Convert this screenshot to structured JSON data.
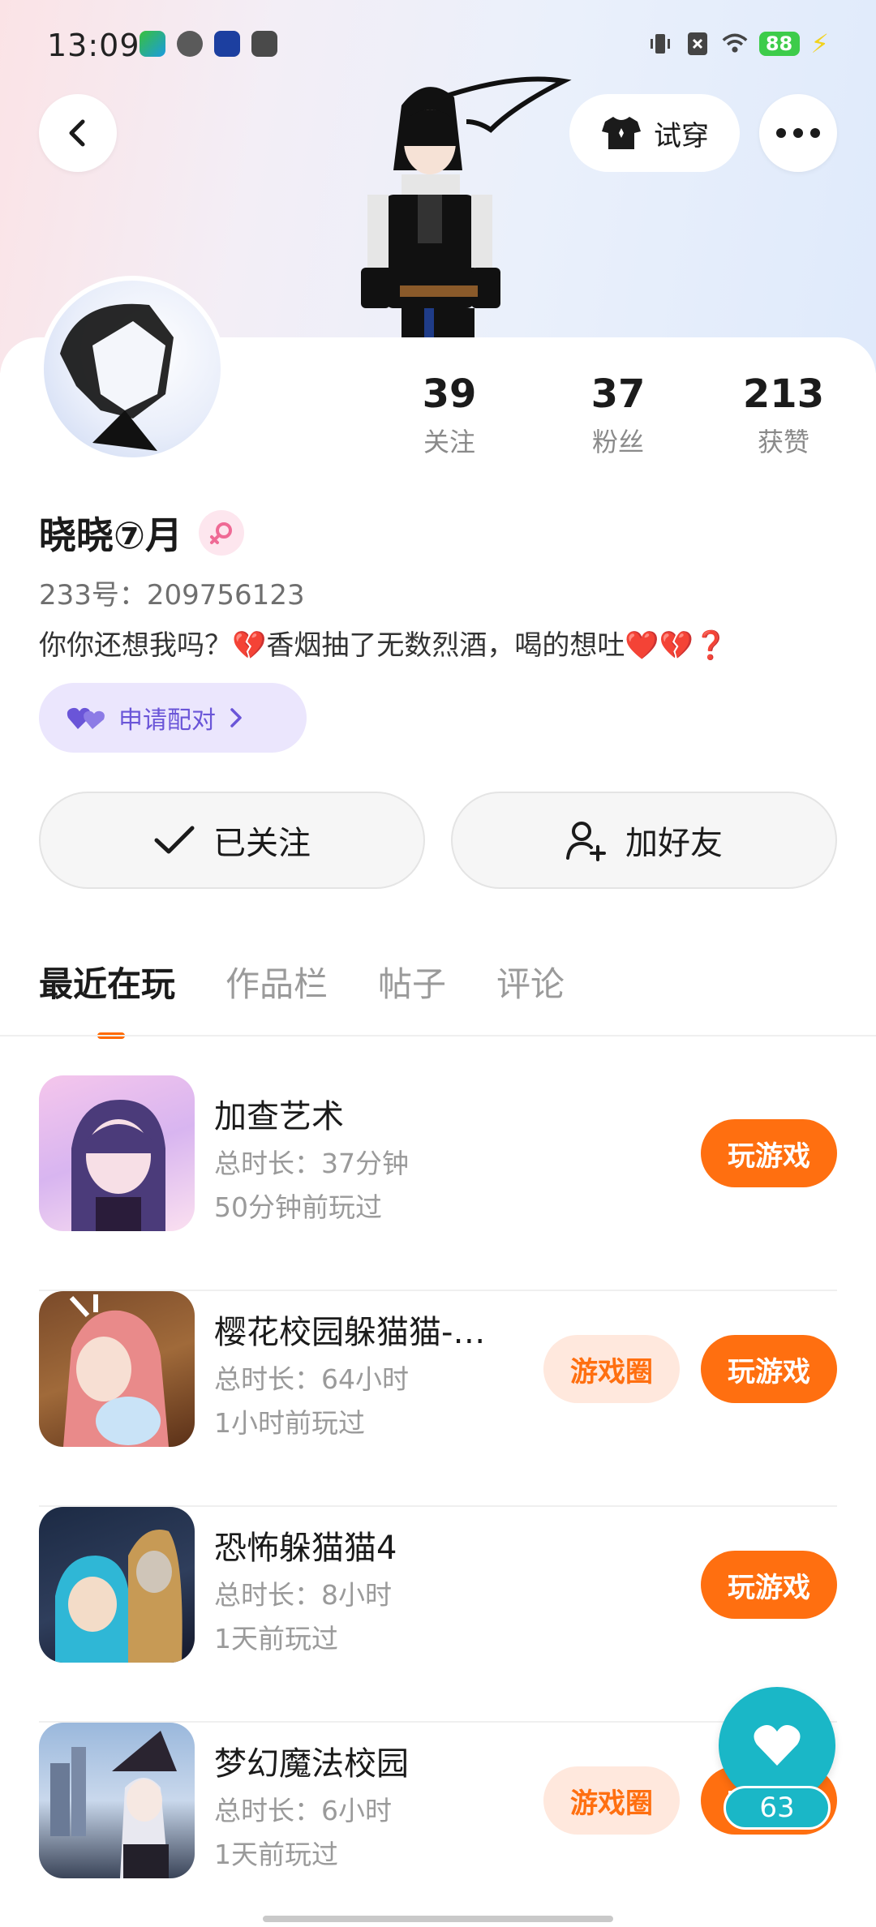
{
  "status_bar": {
    "time": "13:09",
    "battery": "88",
    "icons": [
      "vibrate-icon",
      "sim-blocked-icon",
      "wifi-icon",
      "battery-icon",
      "charging-icon"
    ]
  },
  "header": {
    "try_on_label": "试穿"
  },
  "stats": [
    {
      "value": "39",
      "label": "关注"
    },
    {
      "value": "37",
      "label": "粉丝"
    },
    {
      "value": "213",
      "label": "获赞"
    }
  ],
  "profile": {
    "name": "晓晓⑦月",
    "uid": "233号：209756123",
    "bio": "你你还想我吗？💔香烟抽了无数烈酒，喝的想吐❤️💔❓",
    "pair_label": "申请配对"
  },
  "actions": {
    "follow_label": "已关注",
    "add_friend_label": "加好友"
  },
  "tabs": [
    "最近在玩",
    "作品栏",
    "帖子",
    "评论"
  ],
  "games": [
    {
      "name": "加查艺术",
      "time": "总时长：37分钟",
      "last": "50分钟前玩过",
      "has_circle": false
    },
    {
      "name": "樱花校园躲猫猫-…",
      "time": "总时长：64小时",
      "last": "1小时前玩过",
      "has_circle": true
    },
    {
      "name": "恐怖躲猫猫4",
      "time": "总时长：8小时",
      "last": "1天前玩过",
      "has_circle": false
    },
    {
      "name": "梦幻魔法校园",
      "time": "总时长：6小时",
      "last": "1天前玩过",
      "has_circle": true
    }
  ],
  "buttons": {
    "play_label": "玩游戏",
    "circle_label": "游戏圈"
  },
  "like_count": "63",
  "colors": {
    "accent": "#ff6f10",
    "pair": "#6a55d8",
    "like": "#1ab7c7"
  }
}
